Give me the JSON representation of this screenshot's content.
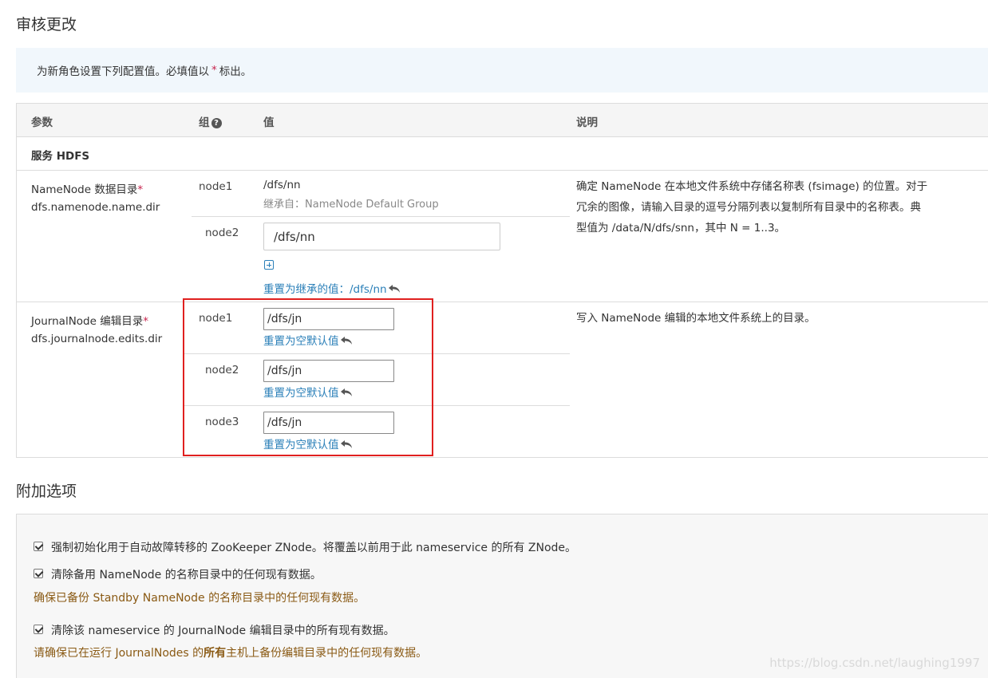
{
  "titles": {
    "review": "审核更改",
    "extra": "附加选项"
  },
  "banner": {
    "text_before": "为新角色设置下列配置值。必填值以",
    "star": "*",
    "text_after": "标出。"
  },
  "table": {
    "headers": {
      "param": "参数",
      "group": "组",
      "group_icon": "question-circle-icon",
      "value": "值",
      "desc": "说明"
    },
    "service_row": "服务 HDFS",
    "namenode": {
      "name": "NameNode 数据目录",
      "star": "*",
      "key": "dfs.namenode.name.dir",
      "node1": {
        "label": "node1",
        "value": "/dfs/nn",
        "inherited": "继承自：NameNode Default Group"
      },
      "node2": {
        "label": "node2",
        "input_value": "/dfs/nn",
        "reset_link": "重置为继承的值：/dfs/nn"
      },
      "desc_lines": [
        "确定 NameNode 在本地文件系统中存储名称表 (fsimage) 的位置。对于",
        "冗余的图像，请输入目录的逗号分隔列表以复制所有目录中的名称表。典",
        "型值为 /data/N/dfs/snn，其中 N = 1..3。"
      ]
    },
    "journalnode": {
      "name": "JournalNode 编辑目录",
      "star": "*",
      "key": "dfs.journalnode.edits.dir",
      "rows": [
        {
          "label": "node1",
          "value": "/dfs/jn",
          "reset_link": "重置为空默认值"
        },
        {
          "label": "node2",
          "value": "/dfs/jn",
          "reset_link": "重置为空默认值"
        },
        {
          "label": "node3",
          "value": "/dfs/jn",
          "reset_link": "重置为空默认值"
        }
      ],
      "desc": "写入 NameNode 编辑的本地文件系统上的目录。"
    }
  },
  "options": {
    "opt1": {
      "checked": true,
      "label": "强制初始化用于自动故障转移的 ZooKeeper ZNode。将覆盖以前用于此 nameservice 的所有 ZNode。"
    },
    "opt2": {
      "checked": true,
      "label": "清除备用 NameNode 的名称目录中的任何现有数据。",
      "warning": "确保已备份 Standby NameNode 的名称目录中的任何现有数据。"
    },
    "opt3": {
      "checked": true,
      "label": "清除该 nameservice 的 JournalNode 编辑目录中的所有现有数据。",
      "warning_before": "请确保已在运行 JournalNodes 的",
      "warning_bold": "所有",
      "warning_after": "主机上备份编辑目录中的任何现有数据。"
    }
  },
  "watermark": "https://blog.csdn.net/laughing1997",
  "colors": {
    "link": "#2a7fb8",
    "required": "#c7254e",
    "warning": "#8a5a14",
    "highlight": "#e0201f"
  }
}
